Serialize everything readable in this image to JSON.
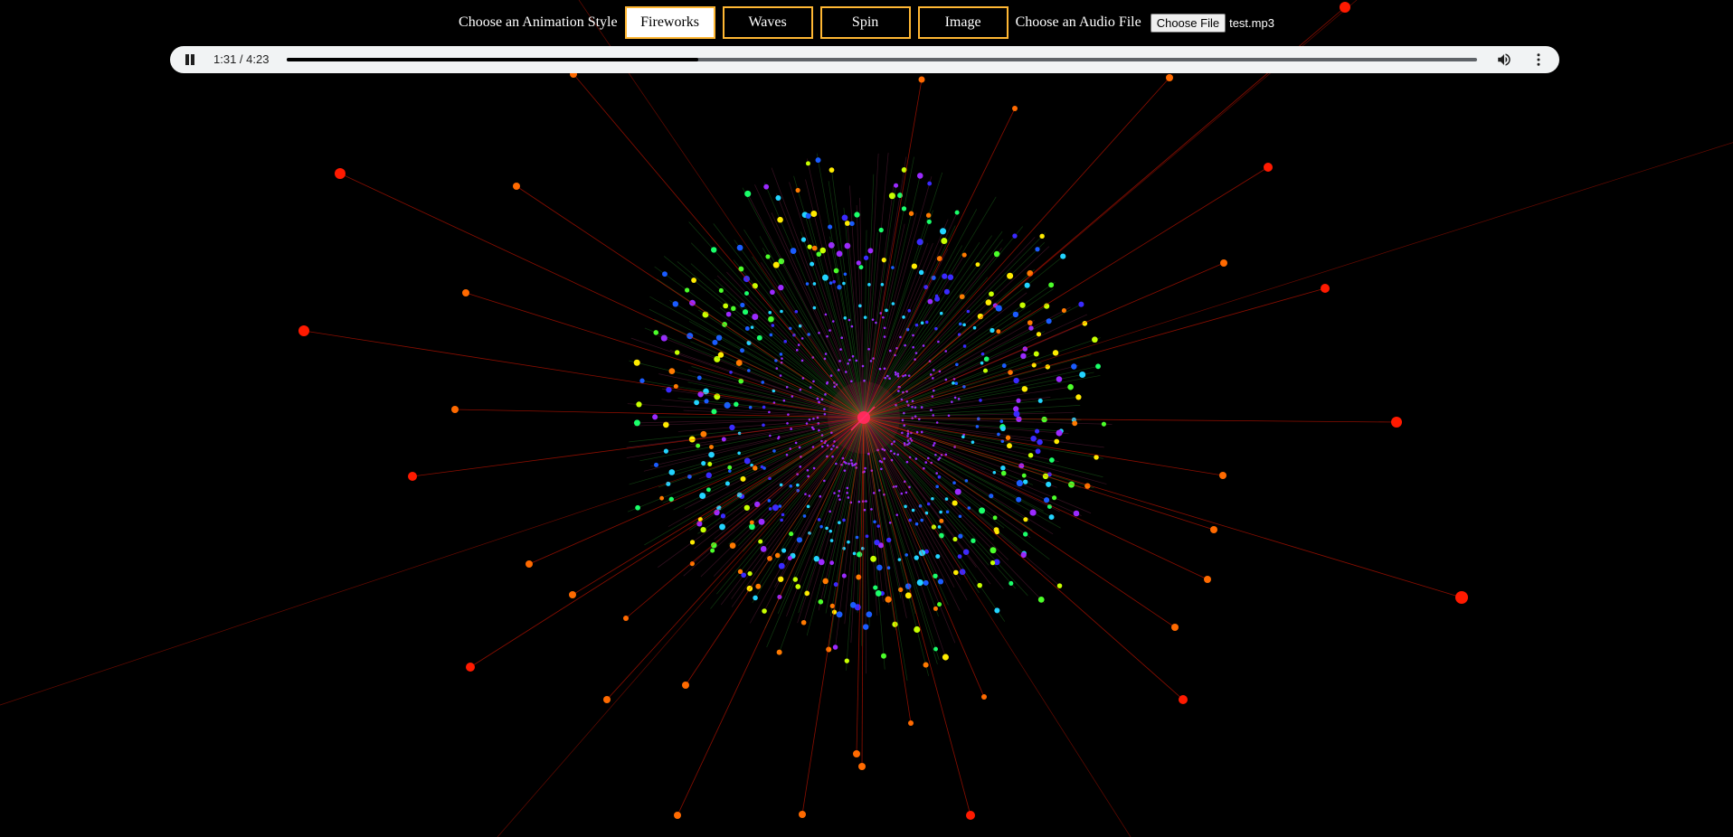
{
  "controls": {
    "animation_label": "Choose an Animation Style",
    "styles": [
      {
        "label": "Fireworks",
        "active": true
      },
      {
        "label": "Waves",
        "active": false
      },
      {
        "label": "Spin",
        "active": false
      },
      {
        "label": "Image",
        "active": false
      }
    ],
    "audio_label": "Choose an Audio File",
    "file_button": "Choose File",
    "file_name": "test.mp3"
  },
  "player": {
    "time": "1:31 / 4:23",
    "progress": 0.346,
    "state": "playing",
    "icons": [
      "pause-icon",
      "volume-icon",
      "more-vert-icon"
    ]
  },
  "visualization": {
    "style": "fireworks",
    "colors": {
      "background": "#000000",
      "button_border": "#ffb733",
      "outer_burst": "#ff1a00",
      "mid_burst": "#ff6a00",
      "core": "#ff2a5a"
    },
    "palette": [
      "#ffeb00",
      "#c8ff00",
      "#4cff2a",
      "#1aff6a",
      "#22d4ff",
      "#1a5cff",
      "#3a2aff",
      "#9b2aff",
      "#ff7a00"
    ]
  }
}
